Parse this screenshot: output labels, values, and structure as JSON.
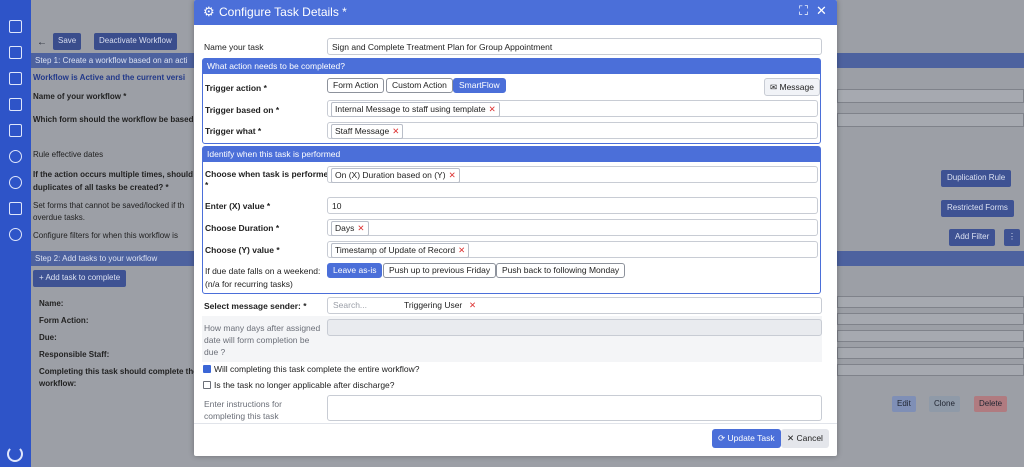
{
  "background": {
    "toolbar": {
      "save": "Save",
      "deactivate": "Deactivate Workflow"
    },
    "step1": "Step 1: Create a workflow based on an acti",
    "active_banner": "Workflow is Active and the current versi",
    "workflow_name_label": "Name of your workflow *",
    "form_label": "Which form should the workflow be based",
    "rule_dates": "Rule effective dates",
    "multi_line1": "If the action occurs multiple times, should",
    "multi_line2": "duplicates of all tasks be created? *",
    "forms_locked_line1": "Set forms that cannot be saved/locked if th",
    "forms_locked_line2": "overdue tasks.",
    "filters": "Configure filters for when this workflow is",
    "step2": "Step 2: Add tasks to your workflow",
    "add_task": "+ Add task to complete",
    "task_fields": {
      "name": "Name:",
      "form_action": "Form Action:",
      "due": "Due:",
      "responsible": "Responsible Staff:",
      "complete1": "Completing this task should complete the",
      "complete2": "workflow:"
    },
    "right_buttons": {
      "duplication": "Duplication Rule",
      "restricted": "Restricted Forms",
      "add_filter": "Add Filter",
      "more": "⋮"
    },
    "task_buttons": {
      "edit": "Edit",
      "clone": "Clone",
      "delete": "Delete"
    }
  },
  "modal": {
    "title": "Configure Task Details *",
    "name_label": "Name your task",
    "name_value": "Sign and Complete Treatment Plan for Group Appointment",
    "section1": "What action needs to be completed?",
    "trigger_action_label": "Trigger action *",
    "trigger_actions": [
      "Form Action",
      "Custom Action",
      "SmartFlow"
    ],
    "message_button": "Message",
    "trigger_on_label": "Trigger based on *",
    "trigger_on_value": "Internal Message to staff using template",
    "trigger_what_label": "Trigger what *",
    "trigger_what_value": "Staff Message",
    "section2": "Identify when this task is performed",
    "when_label_1": "Choose when task is performed",
    "when_label_2": "*",
    "when_value": "On (X) Duration based on (Y)",
    "x_label": "Enter (X) value *",
    "x_value": "10",
    "duration_label": "Choose Duration *",
    "duration_value": "Days",
    "y_label": "Choose (Y) value *",
    "y_value": "Timestamp of Update of Record",
    "weekend_label_1": "If due date falls on a weekend:",
    "weekend_label_2": "(n/a for recurring tasks)",
    "weekend_options": [
      "Leave as-is",
      "Push up to previous Friday",
      "Push back to following Monday"
    ],
    "sender_label": "Select message sender: *",
    "sender_placeholder": "Search...",
    "sender_value": "Triggering User",
    "days_label": "How many days after assigned date will form completion be due ?",
    "complete_workflow_label": "Will completing this task complete the entire workflow?",
    "no_longer_label": "Is the task no longer applicable after discharge?",
    "instructions_label": "Enter instructions for completing this task",
    "update_button": "Update Task",
    "cancel_button": "Cancel"
  }
}
